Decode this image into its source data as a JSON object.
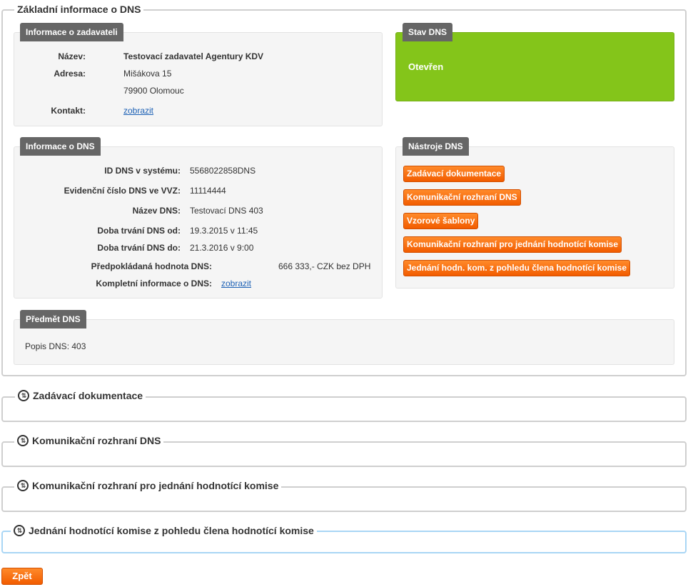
{
  "main": {
    "legend": "Základní informace o DNS",
    "zadavatel": {
      "tab": "Informace o zadavateli",
      "nazev_label": "Název:",
      "nazev_value": "Testovací zadavatel Agentury KDV",
      "adresa_label": "Adresa:",
      "adresa_line1": "Mišákova 15",
      "adresa_line2": "79900 Olomouc",
      "kontakt_label": "Kontakt:",
      "kontakt_link": "zobrazit"
    },
    "stav": {
      "tab": "Stav DNS",
      "value": "Otevřen",
      "color": "#84c51a"
    },
    "dns_info": {
      "tab": "Informace o DNS",
      "rows": [
        {
          "label": "ID DNS v systému:",
          "value": "5568022858DNS"
        },
        {
          "label": "Evidenční číslo DNS ve VVZ:",
          "value": "11114444"
        },
        {
          "label": "Název DNS:",
          "value": "Testovací DNS 403"
        },
        {
          "label": "Doba trvání DNS od:",
          "value": "19.3.2015 v 11:45"
        },
        {
          "label": "Doba trvání DNS do:",
          "value": "21.3.2016 v 9:00"
        }
      ],
      "hodnota_label": "Předpokládaná hodnota DNS:",
      "hodnota_value": "666 333,- CZK bez DPH",
      "kompletni_label": "Kompletní informace o DNS:",
      "kompletni_link": "zobrazit"
    },
    "nastroje": {
      "tab": "Nástroje DNS",
      "buttons": [
        "Zadávací dokumentace",
        "Komunikační rozhraní DNS",
        "Vzorové šablony",
        "Komunikační rozhraní pro jednání hodnotící komise",
        "Jednání hodn. kom. z pohledu člena hodnotící komise"
      ]
    },
    "predmet": {
      "tab": "Předmět DNS",
      "popis": "Popis DNS: 403"
    }
  },
  "sections": [
    "Zadávací dokumentace",
    "Komunikační rozhraní DNS",
    "Komunikační rozhraní pro jednání hodnotící komise",
    "Jednání hodnotící komise z pohledu člena hodnotící komise"
  ],
  "back_label": "Zpět",
  "colors": {
    "accent": "#f25c00",
    "tab": "#666666",
    "active_border": "#a9d6f5"
  }
}
